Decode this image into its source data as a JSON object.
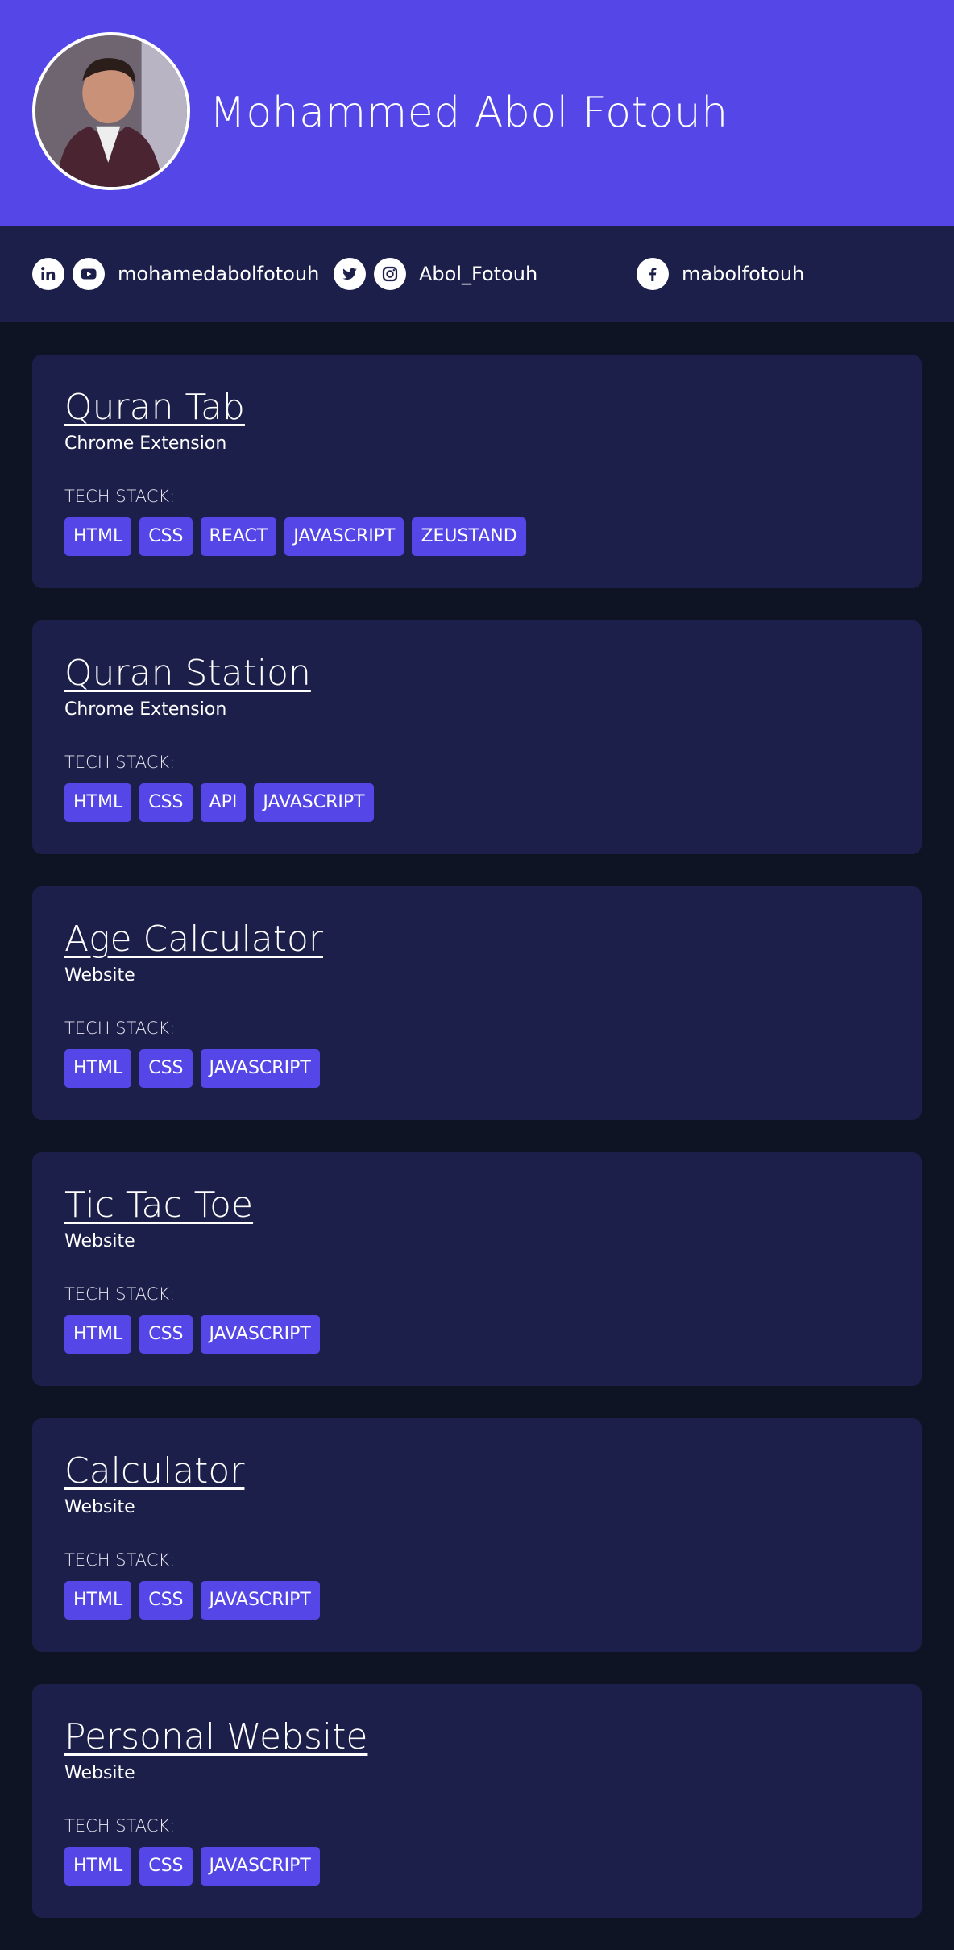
{
  "profile": {
    "name": "Mohammed Abol Fotouh",
    "avatar_icon": "person-photo"
  },
  "social": [
    {
      "icons": [
        "linkedin-icon",
        "youtube-icon"
      ],
      "handle": "mohamedabolfotouh"
    },
    {
      "icons": [
        "twitter-icon",
        "instagram-icon"
      ],
      "handle": "Abol_Fotouh"
    },
    {
      "icons": [
        "facebook-icon"
      ],
      "handle": "mabolfotouh"
    }
  ],
  "tech_label": "TECH STACK:",
  "projects": [
    {
      "title": "Quran Tab",
      "type": "Chrome Extension",
      "stack": [
        "HTML",
        "CSS",
        "REACT",
        "JAVASCRIPT",
        "ZEUSTAND"
      ]
    },
    {
      "title": "Quran Station",
      "type": "Chrome Extension",
      "stack": [
        "HTML",
        "CSS",
        "API",
        "JAVASCRIPT"
      ]
    },
    {
      "title": "Age Calculator",
      "type": "Website",
      "stack": [
        "HTML",
        "CSS",
        "JAVASCRIPT"
      ]
    },
    {
      "title": "Tic Tac Toe",
      "type": "Website",
      "stack": [
        "HTML",
        "CSS",
        "JAVASCRIPT"
      ]
    },
    {
      "title": "Calculator",
      "type": "Website",
      "stack": [
        "HTML",
        "CSS",
        "JAVASCRIPT"
      ]
    },
    {
      "title": "Personal Website",
      "type": "Website",
      "stack": [
        "HTML",
        "CSS",
        "JAVASCRIPT"
      ]
    }
  ],
  "colors": {
    "accent": "#5546e8",
    "card": "#1d1f4b",
    "background": "#0f1424",
    "text": "#ffffff"
  }
}
